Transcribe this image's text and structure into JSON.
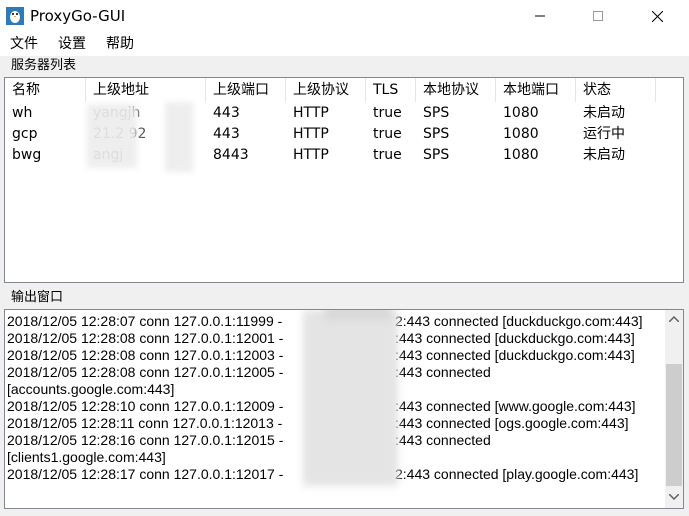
{
  "window": {
    "title": "ProxyGo-GUI"
  },
  "menu": {
    "items": [
      "文件",
      "设置",
      "帮助"
    ]
  },
  "servers": {
    "group_label": "服务器列表",
    "columns": [
      "名称",
      "上级地址",
      "上级端口",
      "上级协议",
      "TLS",
      "本地协议",
      "本地端口",
      "状态"
    ],
    "rows": [
      {
        "name": "wh",
        "upstream_addr": "yangjh",
        "upstream_port": "443",
        "upstream_proto": "HTTP",
        "tls": "true",
        "local_proto": "SPS",
        "local_port": "1080",
        "status": "未启动"
      },
      {
        "name": "gcp",
        "upstream_addr": "21.2  92",
        "upstream_port": "443",
        "upstream_proto": "HTTP",
        "tls": "true",
        "local_proto": "SPS",
        "local_port": "1080",
        "status": "运行中"
      },
      {
        "name": "bwg",
        "upstream_addr": "angj",
        "upstream_port": "8443",
        "upstream_proto": "HTTP",
        "tls": "true",
        "local_proto": "SPS",
        "local_port": "1080",
        "status": "未启动"
      }
    ]
  },
  "output": {
    "group_label": "输出窗口",
    "lines": [
      {
        "left": "2018/12/05 12:28:07 conn 127.0.0.1:11999 -",
        "right": "2:443 connected [duckduckgo.com:443]"
      },
      {
        "left": "2018/12/05 12:28:08 conn 127.0.0.1:12001 -",
        "right": ":443 connected [duckduckgo.com:443]"
      },
      {
        "left": "2018/12/05 12:28:08 conn 127.0.0.1:12003 -",
        "right": ":443 connected [duckduckgo.com:443]"
      },
      {
        "left": "2018/12/05 12:28:08 conn 127.0.0.1:12005 -",
        "right": ":443 connected"
      },
      {
        "left": "[accounts.google.com:443]",
        "right": ""
      },
      {
        "left": "2018/12/05 12:28:10 conn 127.0.0.1:12009 -",
        "right": ":443 connected [www.google.com:443]"
      },
      {
        "left": "2018/12/05 12:28:11 conn 127.0.0.1:12013 -",
        "right": ":443 connected [ogs.google.com:443]"
      },
      {
        "left": "2018/12/05 12:28:16 conn 127.0.0.1:12015 -",
        "right": ":443 connected"
      },
      {
        "left": "[clients1.google.com:443]",
        "right": ""
      },
      {
        "left": "2018/12/05 12:28:17 conn 127.0.0.1:12017 -",
        "right": "2:443 connected [play.google.com:443]"
      }
    ]
  }
}
